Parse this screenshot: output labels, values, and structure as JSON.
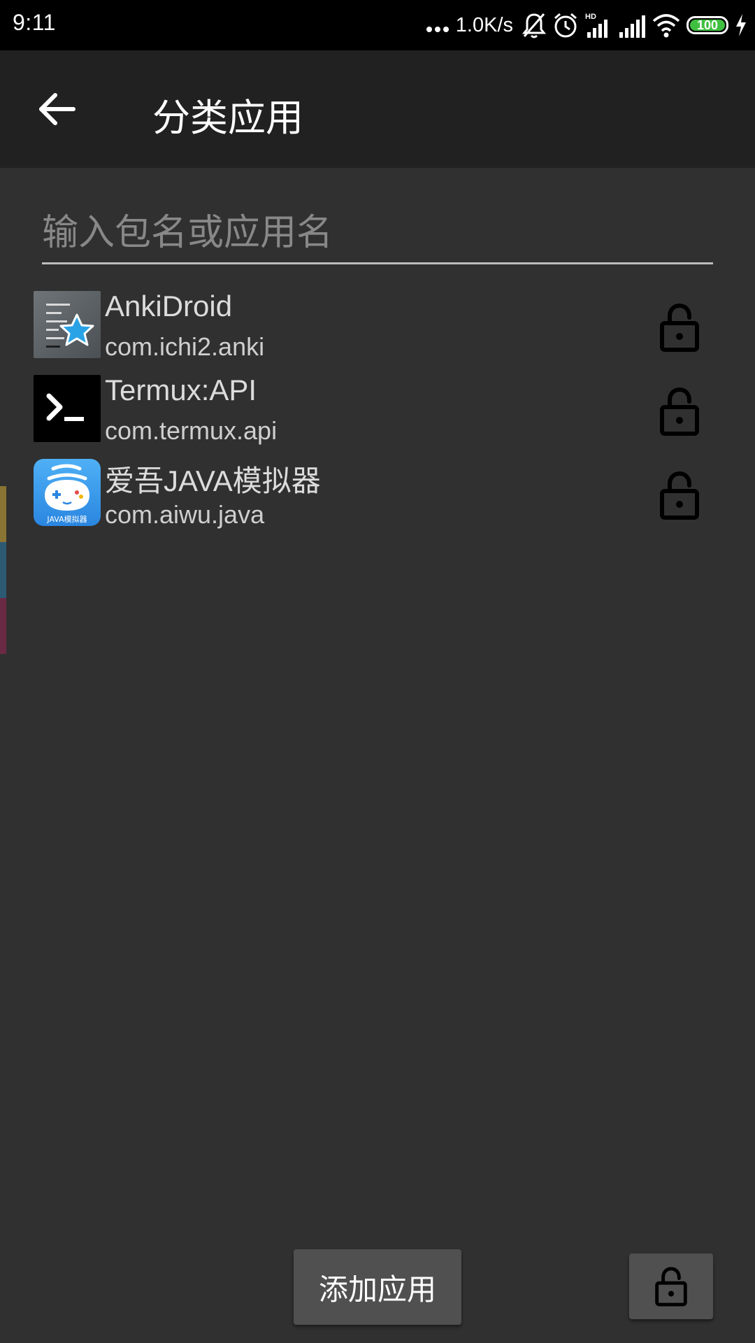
{
  "status_bar": {
    "time": "9:11",
    "network_speed": "1.0K/s",
    "network_type": "HD",
    "battery_level": "100",
    "icons": [
      "more-dots-icon",
      "mute-notification-icon",
      "alarm-icon",
      "signal-icon",
      "signal-icon",
      "wifi-icon",
      "battery-icon",
      "charging-icon"
    ]
  },
  "app_bar": {
    "title": "分类应用",
    "back_icon": "arrow-left-icon"
  },
  "search": {
    "placeholder": "输入包名或应用名",
    "value": ""
  },
  "apps": [
    {
      "name": "AnkiDroid",
      "package": "com.ichi2.anki",
      "icon": "ankidroid-app-icon",
      "lock_icon": "unlock-icon"
    },
    {
      "name": "Termux:API",
      "package": "com.termux.api",
      "icon": "termux-app-icon",
      "lock_icon": "unlock-icon"
    },
    {
      "name": "爱吾JAVA模拟器",
      "package": "com.aiwu.java",
      "icon": "aiwu-java-app-icon",
      "icon_caption": "JAVA模拟器",
      "lock_icon": "unlock-icon"
    }
  ],
  "edge_tabs": {
    "colors": [
      "#8a7433",
      "#2c5a73",
      "#6b2a44"
    ]
  },
  "bottom_bar": {
    "add_button_label": "添加应用",
    "lock_button_icon": "unlock-icon"
  },
  "colors": {
    "background": "#303030",
    "app_bar": "#212121",
    "status_bar": "#000000",
    "button": "#505050",
    "battery_fill": "#3fbf3f"
  }
}
